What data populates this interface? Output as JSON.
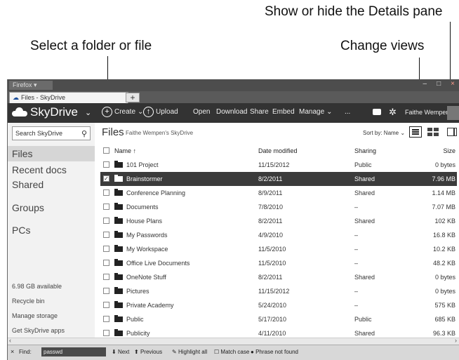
{
  "callouts": {
    "details_pane": "Show or hide the Details pane",
    "select": "Select a folder or file",
    "views": "Change views"
  },
  "browser": {
    "app_menu": "Firefox",
    "tab_title": "Files - SkyDrive",
    "new_tab": "+",
    "controls": [
      "–",
      "□",
      "×"
    ]
  },
  "commandbar": {
    "brand": "SkyDrive",
    "create": "Create",
    "upload": "Upload",
    "open": "Open",
    "download": "Download",
    "share": "Share",
    "embed": "Embed",
    "manage": "Manage",
    "more": "...",
    "user": "Faithe Wempen"
  },
  "sidebar": {
    "search_placeholder": "Search SkyDrive",
    "nav": {
      "files": "Files",
      "recent": "Recent docs",
      "shared": "Shared",
      "groups": "Groups",
      "pcs": "PCs"
    },
    "storage": "6.98 GB available",
    "recycle": "Recycle bin",
    "manage_storage": "Manage storage",
    "get_apps": "Get SkyDrive apps"
  },
  "main": {
    "heading": "Files",
    "owner": "Faithe Wempen's SkyDrive",
    "sort_by": "Sort by: Name ⌄",
    "columns": {
      "name": "Name ↑",
      "date": "Date modified",
      "sharing": "Sharing",
      "size": "Size"
    },
    "rows": [
      {
        "name": "101 Project",
        "date": "11/15/2012",
        "sharing": "Public",
        "size": "0 bytes",
        "checked": ""
      },
      {
        "name": "Brainstormer",
        "date": "8/2/2011",
        "sharing": "Shared",
        "size": "7.96 MB",
        "checked": "✓"
      },
      {
        "name": "Conference Planning",
        "date": "8/9/2011",
        "sharing": "Shared",
        "size": "1.14 MB",
        "checked": ""
      },
      {
        "name": "Documents",
        "date": "7/8/2010",
        "sharing": "–",
        "size": "7.07 MB",
        "checked": ""
      },
      {
        "name": "House Plans",
        "date": "8/2/2011",
        "sharing": "Shared",
        "size": "102 KB",
        "checked": ""
      },
      {
        "name": "My Passwords",
        "date": "4/9/2010",
        "sharing": "–",
        "size": "16.8 KB",
        "checked": ""
      },
      {
        "name": "My Workspace",
        "date": "11/5/2010",
        "sharing": "–",
        "size": "10.2 KB",
        "checked": ""
      },
      {
        "name": "Office Live Documents",
        "date": "11/5/2010",
        "sharing": "–",
        "size": "48.2 KB",
        "checked": ""
      },
      {
        "name": "OneNote Stuff",
        "date": "8/2/2011",
        "sharing": "Shared",
        "size": "0 bytes",
        "checked": ""
      },
      {
        "name": "Pictures",
        "date": "11/15/2012",
        "sharing": "–",
        "size": "0 bytes",
        "checked": ""
      },
      {
        "name": "Private Academy",
        "date": "5/24/2010",
        "sharing": "–",
        "size": "575 KB",
        "checked": ""
      },
      {
        "name": "Public",
        "date": "5/17/2010",
        "sharing": "Public",
        "size": "685 KB",
        "checked": ""
      },
      {
        "name": "Publicity",
        "date": "4/11/2010",
        "sharing": "Shared",
        "size": "96.3 KB",
        "checked": ""
      }
    ]
  },
  "findbar": {
    "close": "×",
    "label": "Find:",
    "value": "passwd",
    "next": "Next",
    "previous": "Previous",
    "highlight": "Highlight all",
    "match_case": "Match case",
    "status": "Phrase not found"
  },
  "colors": {
    "commandbar": "#333333",
    "selected_row": "#3b3b3b",
    "sidebar": "#f2f2f2"
  }
}
